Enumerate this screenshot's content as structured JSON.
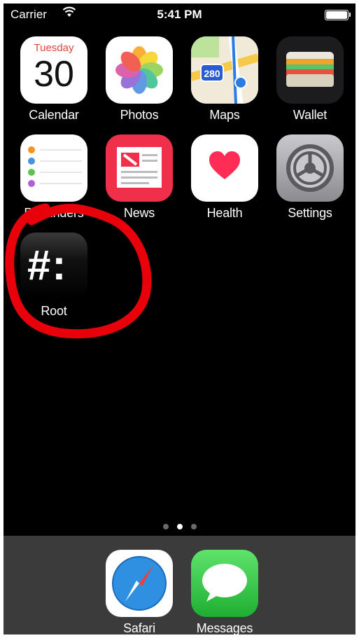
{
  "status_bar": {
    "carrier": "Carrier",
    "time": "5:41 PM"
  },
  "apps": [
    {
      "label": "Calendar",
      "icon": "calendar-icon",
      "calendar_day_of_week": "Tuesday",
      "calendar_day": "30"
    },
    {
      "label": "Photos",
      "icon": "photos-icon"
    },
    {
      "label": "Maps",
      "icon": "maps-icon",
      "road_sign": "280"
    },
    {
      "label": "Wallet",
      "icon": "wallet-icon"
    },
    {
      "label": "Reminders",
      "icon": "reminders-icon"
    },
    {
      "label": "News",
      "icon": "news-icon"
    },
    {
      "label": "Health",
      "icon": "health-icon"
    },
    {
      "label": "Settings",
      "icon": "settings-icon"
    },
    {
      "label": "Root",
      "icon": "terminal-icon",
      "glyph": "#:"
    }
  ],
  "page_indicator": {
    "count": 3,
    "active": 2
  },
  "dock": [
    {
      "label": "Safari",
      "icon": "safari-icon"
    },
    {
      "label": "Messages",
      "icon": "messages-icon"
    }
  ],
  "annotation": {
    "shape": "red-hand-drawn-circle",
    "color": "#e8000b",
    "target": "Root"
  }
}
